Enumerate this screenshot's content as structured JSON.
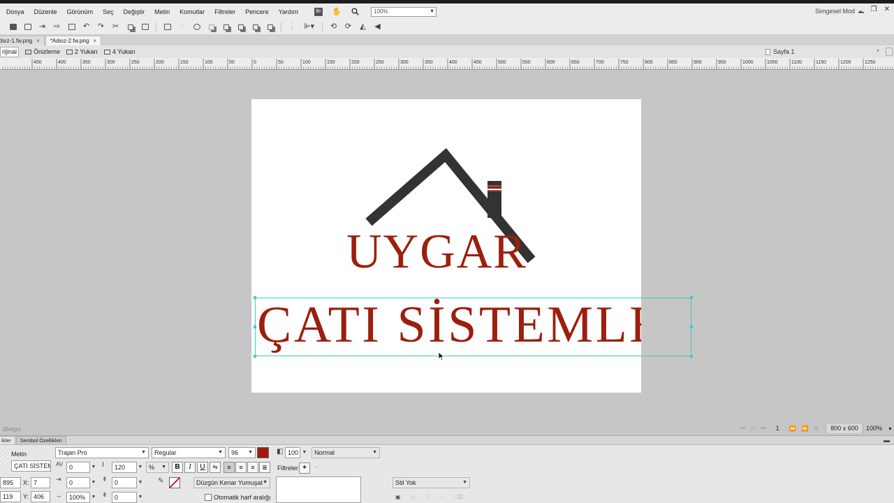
{
  "menubar": {
    "items": [
      "Dosya",
      "Düzenle",
      "Görünüm",
      "Seç",
      "Değiştir",
      "Metin",
      "Komutlar",
      "Filtreler",
      "Pencere",
      "Yardım"
    ],
    "bridge_icon_text": "Br",
    "zoom": "100%",
    "mode": "Simgesel Mod"
  },
  "tabs": {
    "documents": [
      {
        "label": "dsız-1.fw.png",
        "close": "×"
      },
      {
        "label": "*Adsız-2.fw.png",
        "close": "×"
      }
    ]
  },
  "viewbar": {
    "views": [
      "rijinal",
      "Önizleme",
      "2 Yukarı",
      "4 Yukarı"
    ],
    "page": "Sayfa 1"
  },
  "ruler": {
    "labels": [
      "450",
      "400",
      "350",
      "300",
      "250",
      "200",
      "150",
      "100",
      "50",
      "0",
      "50",
      "100",
      "150",
      "200",
      "250",
      "300",
      "350",
      "400",
      "450",
      "500",
      "550",
      "600",
      "650",
      "700",
      "750",
      "800",
      "850",
      "900",
      "950",
      "1000",
      "1050",
      "1100",
      "1150",
      "1200",
      "1250"
    ]
  },
  "canvas": {
    "brand": "UYGAR",
    "subtitle": "ÇATI SİSTEMLER",
    "brand_color": "#9c1f0e",
    "roof_color": "#333333",
    "selection_color": "#3dc9c9"
  },
  "status": {
    "left": "(Belge)",
    "frame": "1",
    "doc_size": "800 x 600",
    "zoom": "100%"
  },
  "properties": {
    "tabs": [
      "ikler",
      "Sembol Özellikleri"
    ],
    "object_type": "Metin",
    "object_name": "ÇATI SİSTEM",
    "font": "Trajan Pro",
    "style": "Regular",
    "size": "96",
    "fill_color": "#a01a0d",
    "opacity": "100",
    "blend": "Normal",
    "kerning": "0",
    "leading": "120",
    "leading_unit": "%",
    "bold": "B",
    "italic": "I",
    "underline": "U",
    "filters_label": "Filtreler",
    "filters_add": "+",
    "indent": "0",
    "space_before": "0",
    "space_after": "0",
    "horizontal_scale": "100%",
    "baseline_shift": "0",
    "anti_alias": "Düzgün Kenar Yumuşat",
    "auto_kern": "Otomatik harf aralığı",
    "style_select": "Stil Yok",
    "w": "895",
    "h": "119",
    "x": "7",
    "y": "406",
    "x_label": "X:",
    "y_label": "Y:"
  }
}
